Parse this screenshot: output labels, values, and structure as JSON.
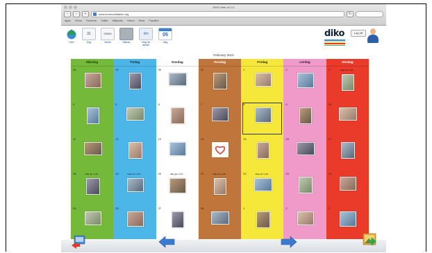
{
  "browser": {
    "window_title": "DIKO Web v0.1.0",
    "address": "www.kommunikation.org",
    "bookmarks": [
      "Apple",
      "iCloud",
      "Facebook",
      "Twitter",
      "Wikipedia",
      "Yahoo!",
      "News",
      "Populära"
    ]
  },
  "toolbar": {
    "items": [
      {
        "name": "home-button",
        "icon": "home-icon",
        "label": "Hem",
        "glyph": ""
      },
      {
        "name": "day-view-button",
        "icon": "day-icon",
        "label": "Dag",
        "glyph": "31"
      },
      {
        "name": "week-view-button",
        "icon": "week-icon",
        "label": "Vecka",
        "glyph": "00000"
      },
      {
        "name": "month-view-button",
        "icon": "month-icon",
        "label": "Månad",
        "glyph": ""
      },
      {
        "name": "previous-button",
        "icon": "arrow-left-icon",
        "label": "Idag att aktuell",
        "glyph": "⇦"
      },
      {
        "name": "today-button",
        "icon": "calendar-icon",
        "label": "Idag",
        "glyph": "05"
      }
    ],
    "logo": "diko",
    "logout_label": "Log off"
  },
  "calendar": {
    "month_title": "February 2013",
    "columns": [
      {
        "day": "Måndag",
        "color": "#74b93a",
        "head_text_color": "#1a3a0a",
        "days": [
          "28",
          "4",
          "11",
          "18",
          "25"
        ],
        "captions": [
          "",
          "",
          "",
          "Idag var vi på...",
          ""
        ]
      },
      {
        "day": "Tisdag",
        "color": "#4db6e8",
        "head_text_color": "#0a2a3a",
        "days": [
          "29",
          "5",
          "12",
          "19",
          "26"
        ],
        "captions": [
          "",
          "",
          "",
          "Idag var vi vid...",
          ""
        ]
      },
      {
        "day": "Onsdag",
        "color": "#ffffff",
        "head_text_color": "#222222",
        "days": [
          "30",
          "6",
          "13",
          "20",
          "27"
        ],
        "captions": [
          "",
          "",
          "",
          "Idag gjo vi på...",
          ""
        ]
      },
      {
        "day": "Torsdag",
        "color": "#c0763a",
        "head_text_color": "#ffffff",
        "days": [
          "31",
          "7",
          "14",
          "21",
          "28"
        ],
        "captions": [
          "",
          "",
          "",
          "Idag var vi på...",
          ""
        ]
      },
      {
        "day": "Fredag",
        "color": "#f6e83a",
        "head_text_color": "#222222",
        "days": [
          "1",
          "8",
          "15",
          "22",
          "1"
        ],
        "captions": [
          "",
          "",
          "",
          "Idag var vi på...",
          ""
        ]
      },
      {
        "day": "Lördag",
        "color": "#ef9ac8",
        "head_text_color": "#3a0a2a",
        "days": [
          "2",
          "9",
          "16",
          "23",
          "2"
        ],
        "captions": [
          "",
          "",
          "",
          "",
          ""
        ]
      },
      {
        "day": "Söndag",
        "color": "#ea3a2a",
        "head_text_color": "#ffffff",
        "days": [
          "3",
          "10",
          "17",
          "24",
          "3"
        ],
        "captions": [
          "Idag var vi på...",
          "",
          "",
          "",
          ""
        ]
      }
    ]
  },
  "footer": {
    "items": [
      "back-icon",
      "arrow-left-icon",
      "arrow-right-icon",
      "add-photo-icon"
    ]
  }
}
